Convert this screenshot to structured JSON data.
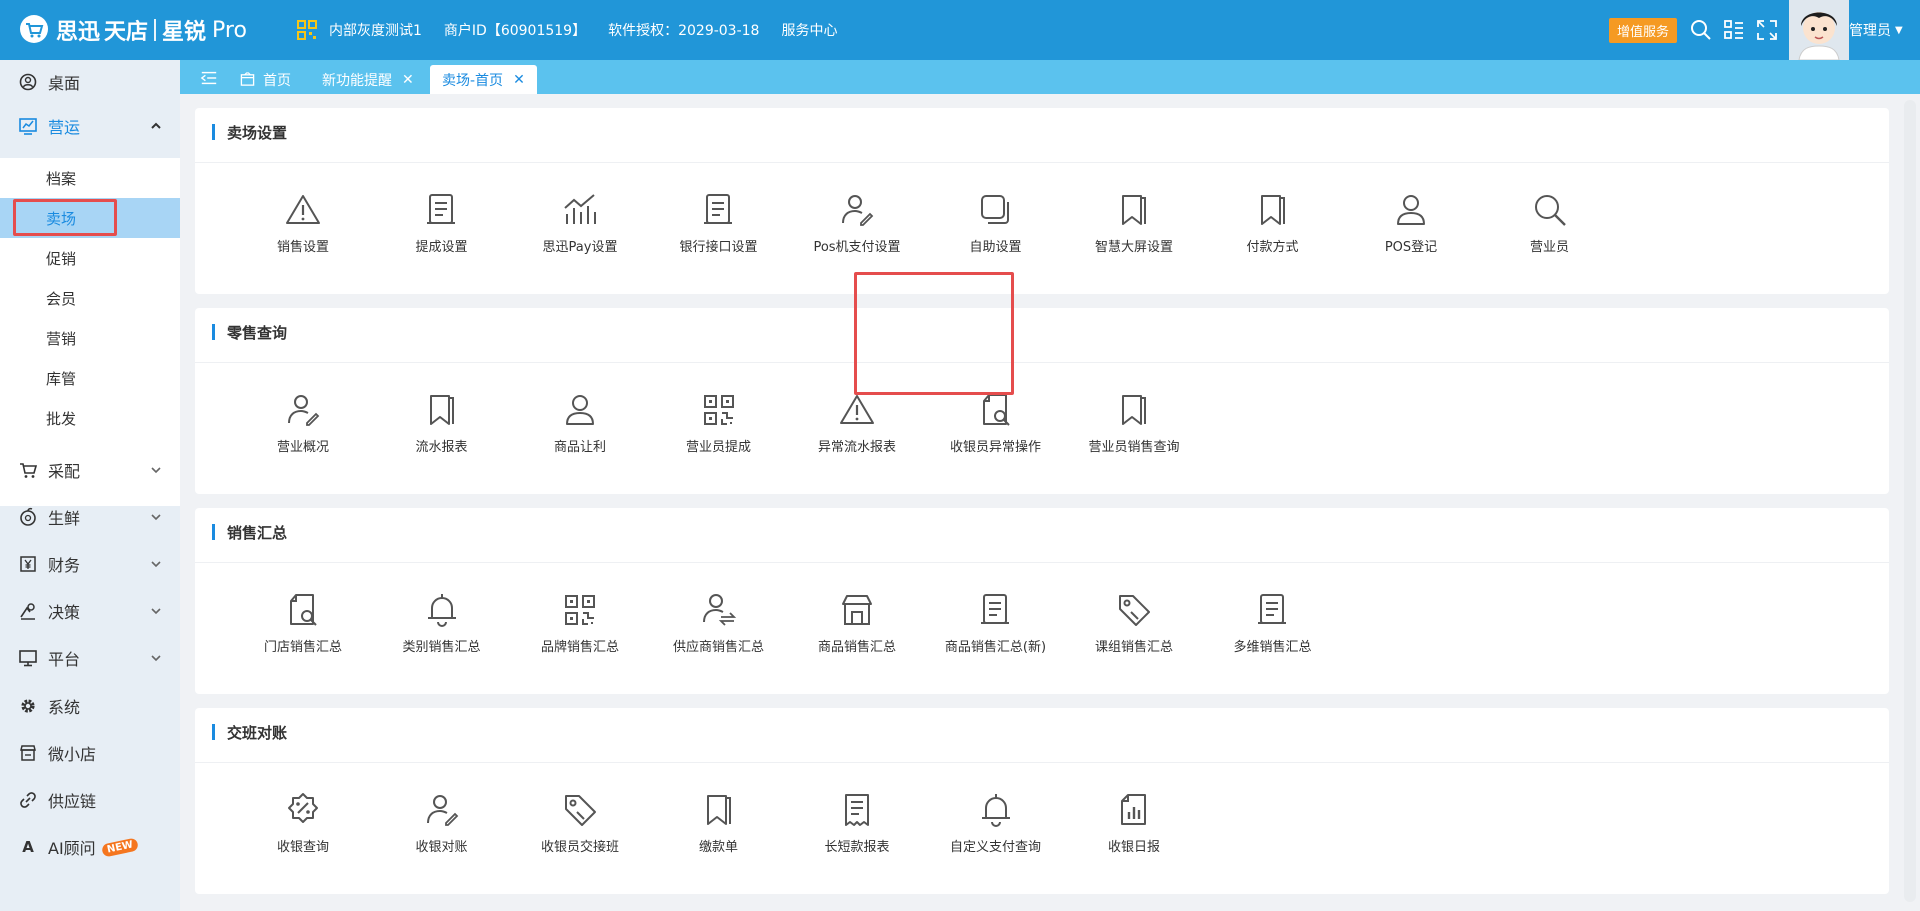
{
  "header": {
    "logo_text": "思迅",
    "logo_tian": "天店",
    "logo_brand": "星锐",
    "logo_pro": "Pro",
    "store_name": "内部灰度测试1",
    "merchant_id": "商户ID【60901519】",
    "license": "软件授权：2029-03-18",
    "service_center": "服务中心",
    "vip_button": "增值服务",
    "admin_label": "管理员"
  },
  "sidebar": {
    "items": [
      {
        "label": "桌面",
        "icon": "desktop-icon"
      },
      {
        "label": "营运",
        "icon": "operation-icon"
      },
      {
        "label": "采配",
        "icon": "cart-icon"
      },
      {
        "label": "生鲜",
        "icon": "fresh-icon"
      },
      {
        "label": "财务",
        "icon": "yen-icon"
      },
      {
        "label": "决策",
        "icon": "decision-icon"
      },
      {
        "label": "平台",
        "icon": "platform-icon"
      },
      {
        "label": "系统",
        "icon": "gear-icon"
      },
      {
        "label": "微小店",
        "icon": "shop-icon"
      },
      {
        "label": "供应链",
        "icon": "link-icon"
      },
      {
        "label": "AI顾问",
        "icon": "ai-icon"
      }
    ],
    "operation_sub": [
      "档案",
      "卖场",
      "促销",
      "会员",
      "营销",
      "库管",
      "批发"
    ],
    "new_badge": "NEW"
  },
  "tabs": [
    {
      "label": "首页"
    },
    {
      "label": "新功能提醒"
    },
    {
      "label": "卖场-首页"
    }
  ],
  "sections": [
    {
      "title": "卖场设置",
      "tiles": [
        {
          "label": "销售设置",
          "icon": "warning-icon"
        },
        {
          "label": "提成设置",
          "icon": "document-icon"
        },
        {
          "label": "思迅Pay设置",
          "icon": "chart-icon"
        },
        {
          "label": "银行接口设置",
          "icon": "document-icon"
        },
        {
          "label": "Pos机支付设置",
          "icon": "user-edit-icon"
        },
        {
          "label": "自助设置",
          "icon": "copy-icon"
        },
        {
          "label": "智慧大屏设置",
          "icon": "bookmark-icon"
        },
        {
          "label": "付款方式",
          "icon": "bookmark-icon"
        },
        {
          "label": "POS登记",
          "icon": "user-icon"
        },
        {
          "label": "营业员",
          "icon": "search-icon"
        }
      ]
    },
    {
      "title": "零售查询",
      "tiles": [
        {
          "label": "营业概况",
          "icon": "user-edit-icon"
        },
        {
          "label": "流水报表",
          "icon": "bookmark-icon"
        },
        {
          "label": "商品让利",
          "icon": "user-icon"
        },
        {
          "label": "营业员提成",
          "icon": "qr-icon"
        },
        {
          "label": "异常流水报表",
          "icon": "warning-icon"
        },
        {
          "label": "收银员异常操作",
          "icon": "file-search-icon"
        },
        {
          "label": "营业员销售查询",
          "icon": "bookmark-icon"
        }
      ]
    },
    {
      "title": "销售汇总",
      "tiles": [
        {
          "label": "门店销售汇总",
          "icon": "file-search-icon"
        },
        {
          "label": "类别销售汇总",
          "icon": "bell-icon"
        },
        {
          "label": "品牌销售汇总",
          "icon": "qr-icon"
        },
        {
          "label": "供应商销售汇总",
          "icon": "user-swap-icon"
        },
        {
          "label": "商品销售汇总",
          "icon": "store-icon"
        },
        {
          "label": "商品销售汇总(新)",
          "icon": "document-icon"
        },
        {
          "label": "课组销售汇总",
          "icon": "tag-icon"
        },
        {
          "label": "多维销售汇总",
          "icon": "document-icon"
        }
      ]
    },
    {
      "title": "交班对账",
      "tiles": [
        {
          "label": "收银查询",
          "icon": "percent-icon"
        },
        {
          "label": "收银对账",
          "icon": "user-edit-icon"
        },
        {
          "label": "收银员交接班",
          "icon": "tag-icon"
        },
        {
          "label": "缴款单",
          "icon": "bookmark-icon"
        },
        {
          "label": "长短款报表",
          "icon": "receipt-icon"
        },
        {
          "label": "自定义支付查询",
          "icon": "bell-icon"
        },
        {
          "label": "收银日报",
          "icon": "daily-report-icon"
        }
      ]
    }
  ],
  "colors": {
    "header": "#2196d8",
    "tabbar": "#5bc2ee",
    "accent": "#1a8be0",
    "highlight": "#e54d4d",
    "vip": "#f59a23"
  }
}
